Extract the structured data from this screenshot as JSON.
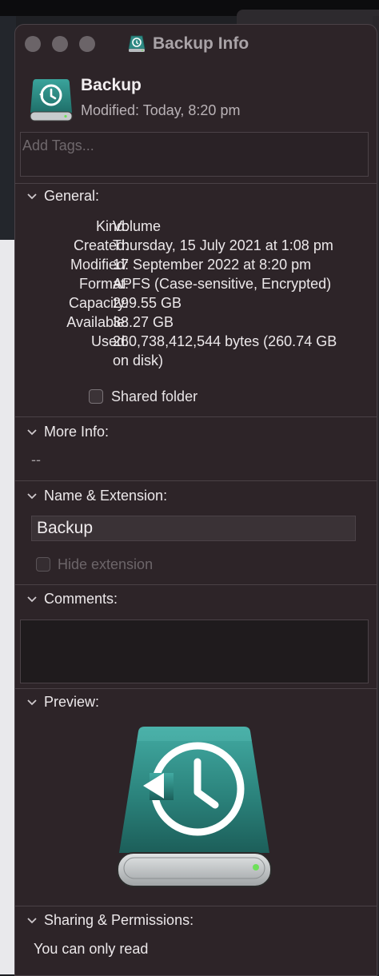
{
  "window": {
    "title": "Backup Info"
  },
  "header": {
    "name": "Backup",
    "modified": "Modified: Today, 8:20 pm"
  },
  "tags": {
    "placeholder": "Add Tags..."
  },
  "general": {
    "heading": "General:",
    "rows": [
      {
        "key": "Kind:",
        "value": "Volume"
      },
      {
        "key": "Created:",
        "value": "Thursday, 15 July 2021 at 1:08 pm"
      },
      {
        "key": "Modified:",
        "value": "17 September 2022 at 8:20 pm"
      },
      {
        "key": "Format:",
        "value": "APFS (Case-sensitive, Encrypted)"
      },
      {
        "key": "Capacity:",
        "value": "299.55 GB"
      },
      {
        "key": "Available:",
        "value": "38.27 GB"
      },
      {
        "key": "Used:",
        "value": "260,738,412,544 bytes (260.74 GB on disk)"
      }
    ],
    "shared_folder_label": "Shared folder",
    "shared_folder_checked": false
  },
  "more_info": {
    "heading": "More Info:",
    "value": "--"
  },
  "name_extension": {
    "heading": "Name & Extension:",
    "name_value": "Backup",
    "hide_extension_label": "Hide extension",
    "hide_extension_disabled": true
  },
  "comments": {
    "heading": "Comments:",
    "value": ""
  },
  "preview": {
    "heading": "Preview:"
  },
  "sharing": {
    "heading": "Sharing & Permissions:",
    "status": "You can only read"
  },
  "colors": {
    "window_bg": "#2d2428",
    "drive_teal": "#2f8a84",
    "led_green": "#6ee05a"
  },
  "icons": [
    "time-machine-drive-icon",
    "chevron-down-icon",
    "checkbox-icon"
  ]
}
